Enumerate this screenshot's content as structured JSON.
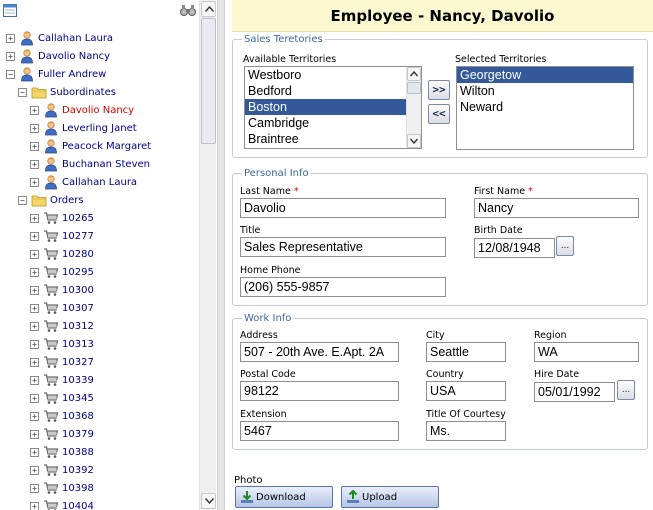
{
  "tree": {
    "nodes": [
      {
        "label": "Callahan Laura",
        "expander": "+",
        "icon": "person-icon",
        "level": 0
      },
      {
        "label": "Davolio Nancy",
        "expander": "+",
        "icon": "person-icon",
        "level": 0
      },
      {
        "label": "Fuller Andrew",
        "expander": "−",
        "icon": "person-icon",
        "level": 0
      },
      {
        "label": "Subordinates",
        "expander": "−",
        "icon": "folder-icon",
        "level": 1
      },
      {
        "label": "Davolio Nancy",
        "expander": "+",
        "icon": "person-icon",
        "level": 2,
        "selected": true
      },
      {
        "label": "Leverling Janet",
        "expander": "+",
        "icon": "person-icon",
        "level": 2
      },
      {
        "label": "Peacock Margaret",
        "expander": "+",
        "icon": "person-icon",
        "level": 2
      },
      {
        "label": "Buchanan Steven",
        "expander": "+",
        "icon": "person-icon",
        "level": 2
      },
      {
        "label": "Callahan Laura",
        "expander": "+",
        "icon": "person-icon",
        "level": 2
      },
      {
        "label": "Orders",
        "expander": "−",
        "icon": "folder-icon",
        "level": 1
      },
      {
        "label": "10265",
        "expander": "+",
        "icon": "cart-icon",
        "level": 2
      },
      {
        "label": "10277",
        "expander": "+",
        "icon": "cart-icon",
        "level": 2
      },
      {
        "label": "10280",
        "expander": "+",
        "icon": "cart-icon",
        "level": 2
      },
      {
        "label": "10295",
        "expander": "+",
        "icon": "cart-icon",
        "level": 2
      },
      {
        "label": "10300",
        "expander": "+",
        "icon": "cart-icon",
        "level": 2
      },
      {
        "label": "10307",
        "expander": "+",
        "icon": "cart-icon",
        "level": 2
      },
      {
        "label": "10312",
        "expander": "+",
        "icon": "cart-icon",
        "level": 2
      },
      {
        "label": "10313",
        "expander": "+",
        "icon": "cart-icon",
        "level": 2
      },
      {
        "label": "10327",
        "expander": "+",
        "icon": "cart-icon",
        "level": 2
      },
      {
        "label": "10339",
        "expander": "+",
        "icon": "cart-icon",
        "level": 2
      },
      {
        "label": "10345",
        "expander": "+",
        "icon": "cart-icon",
        "level": 2
      },
      {
        "label": "10368",
        "expander": "+",
        "icon": "cart-icon",
        "level": 2
      },
      {
        "label": "10379",
        "expander": "+",
        "icon": "cart-icon",
        "level": 2
      },
      {
        "label": "10388",
        "expander": "+",
        "icon": "cart-icon",
        "level": 2
      },
      {
        "label": "10392",
        "expander": "+",
        "icon": "cart-icon",
        "level": 2
      },
      {
        "label": "10398",
        "expander": "+",
        "icon": "cart-icon",
        "level": 2
      },
      {
        "label": "10404",
        "expander": "+",
        "icon": "cart-icon",
        "level": 2
      }
    ]
  },
  "form": {
    "title": "Employee - Nancy, Davolio",
    "sales": {
      "legend": "Sales Teretories",
      "available_label": "Available Territories",
      "selected_label": "Selected Territories",
      "available": [
        "Westboro",
        "Bedford",
        "Boston",
        "Cambridge",
        "Braintree"
      ],
      "available_highlighted": "Boston",
      "selected": [
        "Georgetow",
        "Wilton",
        "Neward"
      ],
      "selected_highlighted": "Georgetow",
      "add_label": ">>",
      "remove_label": "<<"
    },
    "personal": {
      "legend": "Personal Info",
      "last_name_label": "Last Name",
      "last_name": "Davolio",
      "first_name_label": "First Name",
      "first_name": "Nancy",
      "required_mark": "*",
      "title_label": "Title",
      "title": "Sales Representative",
      "birth_date_label": "Birth Date",
      "birth_date": "12/08/1948",
      "home_phone_label": "Home Phone",
      "home_phone": "(206) 555-9857",
      "date_button_label": "..."
    },
    "work": {
      "legend": "Work Info",
      "address_label": "Address",
      "address": "507 - 20th Ave. E.Apt. 2A",
      "city_label": "City",
      "city": "Seattle",
      "region_label": "Region",
      "region": "WA",
      "postal_code_label": "Postal Code",
      "postal_code": "98122",
      "country_label": "Country",
      "country": "USA",
      "hire_date_label": "Hire Date",
      "hire_date": "05/01/1992",
      "extension_label": "Extension",
      "extension": "5467",
      "courtesy_label": "Title Of Courtesy",
      "courtesy": "Ms.",
      "date_button_label": "..."
    },
    "photo": {
      "label": "Photo",
      "download_label": "Download",
      "upload_label": "Upload"
    }
  },
  "colors": {
    "title_bg": "#fcf8cf",
    "list_highlight": "#33599b",
    "tree_link": "#00008b",
    "tree_selected": "#d00000",
    "legend_text": "#3c6a9e"
  }
}
